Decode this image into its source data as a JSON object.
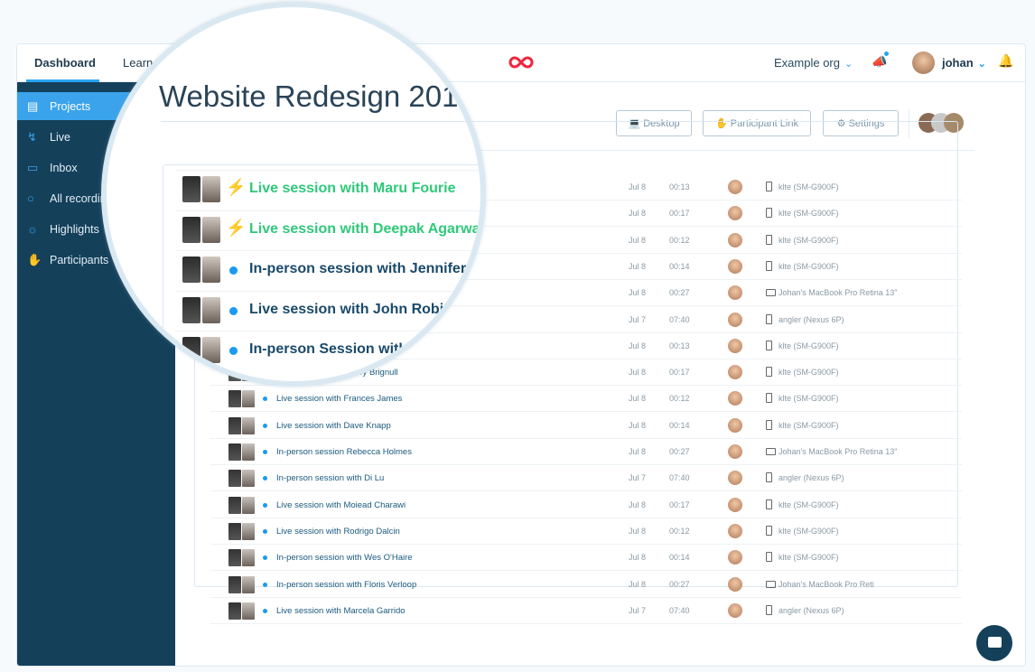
{
  "nav": {
    "tabs": [
      "Dashboard",
      "Learn"
    ],
    "org": "Example org",
    "user": "johan"
  },
  "sidebar": {
    "items": [
      {
        "label": "Projects",
        "icon": "inbox-tray-icon"
      },
      {
        "label": "Live",
        "icon": "bolt-icon"
      },
      {
        "label": "Inbox",
        "icon": "inbox-icon"
      },
      {
        "label": "All recordings",
        "icon": "circle-icon"
      },
      {
        "label": "Highlights",
        "icon": "sun-icon"
      },
      {
        "label": "Participants",
        "icon": "hand-icon"
      }
    ]
  },
  "page": {
    "title": "Website Redesign 201"
  },
  "toolbar": {
    "desktop": "Desktop",
    "participant_link": "Participant Link",
    "settings": "Settings"
  },
  "colors": {
    "accent": "#2aa3f0",
    "sidebar": "#14405a",
    "live": "#2fc97a"
  },
  "sessions": [
    {
      "title": "Live session with Maru Fourie",
      "live": true,
      "date": "Jul 8",
      "duration": "00:13",
      "device": "klte (SM-G900F)",
      "device_type": "phone"
    },
    {
      "title": "Live session with Deepak Agarwal",
      "live": true,
      "date": "Jul 8",
      "duration": "00:17",
      "device": "klte (SM-G900F)",
      "device_type": "phone"
    },
    {
      "title": "In-person session with Jennifer",
      "live": false,
      "date": "Jul 8",
      "duration": "00:12",
      "device": "klte (SM-G900F)",
      "device_type": "phone"
    },
    {
      "title": "Live session with John Robin",
      "live": false,
      "date": "Jul 8",
      "duration": "00:14",
      "device": "klte (SM-G900F)",
      "device_type": "phone"
    },
    {
      "title": "In-person Session with",
      "live": false,
      "date": "Jul 8",
      "duration": "00:27",
      "device": "Johan's MacBook Pro Retina 13\"",
      "device_type": "laptop"
    },
    {
      "title": "",
      "live": false,
      "date": "Jul 7",
      "duration": "07:40",
      "device": "angler (Nexus 6P)",
      "device_type": "phone"
    },
    {
      "title": "",
      "live": false,
      "date": "Jul 8",
      "duration": "00:13",
      "device": "klte (SM-G900F)",
      "device_type": "phone"
    },
    {
      "title": "Dark session with Harry Brignull",
      "live": false,
      "date": "Jul 8",
      "duration": "00:17",
      "device": "klte (SM-G900F)",
      "device_type": "phone"
    },
    {
      "title": "Live session with Frances James",
      "live": false,
      "date": "Jul 8",
      "duration": "00:12",
      "device": "klte (SM-G900F)",
      "device_type": "phone"
    },
    {
      "title": "Live session with Dave Knapp",
      "live": false,
      "date": "Jul 8",
      "duration": "00:14",
      "device": "klte (SM-G900F)",
      "device_type": "phone"
    },
    {
      "title": "In-person session Rebecca Holmes",
      "live": false,
      "date": "Jul 8",
      "duration": "00:27",
      "device": "Johan's MacBook Pro Retina 13\"",
      "device_type": "laptop"
    },
    {
      "title": "In-person session with Di Lu",
      "live": false,
      "date": "Jul 7",
      "duration": "07:40",
      "device": "angler (Nexus 6P)",
      "device_type": "phone"
    },
    {
      "title": "Live session with Moiead Charawi",
      "live": false,
      "date": "Jul 8",
      "duration": "00:17",
      "device": "klte (SM-G900F)",
      "device_type": "phone"
    },
    {
      "title": "Live session with Rodrigo Dalcin",
      "live": false,
      "date": "Jul 8",
      "duration": "00:12",
      "device": "klte (SM-G900F)",
      "device_type": "phone"
    },
    {
      "title": "In-person session with Wes O'Haire",
      "live": false,
      "date": "Jul 8",
      "duration": "00:14",
      "device": "klte (SM-G900F)",
      "device_type": "phone"
    },
    {
      "title": "In-person session with Floris Verloop",
      "live": false,
      "date": "Jul 8",
      "duration": "00:27",
      "device": "Johan's MacBook Pro Reti",
      "device_type": "laptop"
    },
    {
      "title": "Live session with Marcela Garrido",
      "live": false,
      "date": "Jul 7",
      "duration": "07:40",
      "device": "angler (Nexus 6P)",
      "device_type": "phone"
    }
  ]
}
